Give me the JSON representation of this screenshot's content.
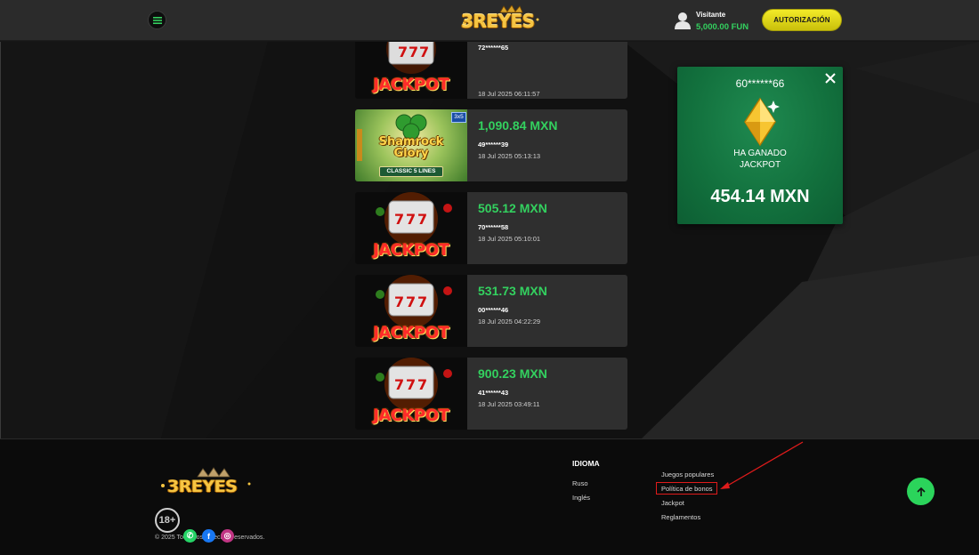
{
  "header": {
    "menu_icon": "hamburger-icon",
    "logo_text": "3REYES",
    "user": {
      "icon": "user-icon",
      "name": "Visitante",
      "balance": "5,000.00 FUN"
    },
    "auth_button": "AUTORIZACIÓN"
  },
  "winners": [
    {
      "game": "Jackpot",
      "thumb_text": "JACKPOT",
      "amount": "",
      "user": "72******65",
      "date": "18 Jul 2025 06:11:57"
    },
    {
      "game": "Shamrock Glory",
      "thumb_title_1": "Shamrock",
      "thumb_title_2": "Glory",
      "thumb_sub": "CLASSIC 5 LINES",
      "badge": "3x5",
      "amount": "1,090.84 MXN",
      "user": "49******39",
      "date": "18 Jul 2025 05:13:13"
    },
    {
      "game": "Jackpot",
      "thumb_text": "JACKPOT",
      "amount": "505.12 MXN",
      "user": "70******58",
      "date": "18 Jul 2025 05:10:01"
    },
    {
      "game": "Jackpot",
      "thumb_text": "JACKPOT",
      "amount": "531.73 MXN",
      "user": "00******46",
      "date": "18 Jul 2025 04:22:29"
    },
    {
      "game": "Jackpot",
      "thumb_text": "JACKPOT",
      "amount": "900.23 MXN",
      "user": "41******43",
      "date": "18 Jul 2025 03:49:11"
    }
  ],
  "popup": {
    "user": "60******66",
    "close_icon": "close-icon",
    "gem_icon": "diamond-icon",
    "label_line1": "HA GANADO",
    "label_line2": "JACKPOT",
    "amount": "454.14 MXN"
  },
  "footer": {
    "logo_text": "3REYES",
    "age_badge": "18+",
    "social": [
      {
        "name": "whatsapp",
        "icon": "whatsapp-icon",
        "glyph": "✆",
        "color": "#25d366"
      },
      {
        "name": "facebook",
        "icon": "facebook-icon",
        "glyph": "f",
        "color": "#1877f2"
      },
      {
        "name": "instagram",
        "icon": "instagram-icon",
        "glyph": "◎",
        "color": "#c13584"
      }
    ],
    "copyright": "© 2025 Todos los derechos reservados.",
    "language": {
      "title": "IDIOMA",
      "items": [
        "Ruso",
        "Inglés"
      ]
    },
    "links": [
      "Juegos populares",
      "Política de bonos",
      "Jackpot",
      "Reglamentos"
    ],
    "highlighted_link": "Política de bonos",
    "to_top_icon": "arrow-up-icon"
  },
  "colors": {
    "accent_green": "#33d15f",
    "auth_yellow": "#f3ea28",
    "popup_green": "#12703d",
    "annotation_red": "#e01b1b"
  }
}
